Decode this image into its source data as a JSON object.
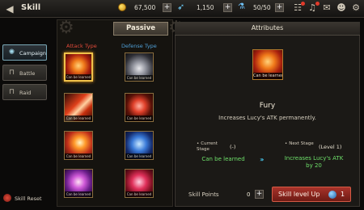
{
  "header": {
    "title": "Skill",
    "gold": "67,500",
    "feathers": "1,150",
    "stamina": "50/50"
  },
  "nav": {
    "items": [
      {
        "label": "Campaign",
        "active": true
      },
      {
        "label": "Battle",
        "active": false
      },
      {
        "label": "Raid",
        "active": false
      }
    ],
    "reset_label": "Skill Reset"
  },
  "skills": {
    "tab_label": "Passive",
    "attack_header": "Attack Type",
    "defense_header": "Defense Type",
    "caption": "Can be learned"
  },
  "attributes": {
    "header": "Attributes",
    "skill_caption": "Can be learned",
    "skill_name": "Fury",
    "description": "Increases Lucy's ATK permanently.",
    "current_stage_label": "Current Stage",
    "current_stage_value": "(-)",
    "current_effect": "Can be learned",
    "next_stage_label": "Next Stage",
    "next_stage_value": "(Level 1)",
    "next_effect_line1": "Increases Lucy's ATK",
    "next_effect_line2": "by 20",
    "skill_points_label": "Skill Points",
    "skill_points_value": "0",
    "level_up_label": "Skill level Up",
    "level_up_cost": "1"
  },
  "colors": {
    "accent_red": "#a8332a",
    "green_text": "#6ee06a",
    "attack_color": "#e04a3a",
    "defense_color": "#4f9fd6"
  }
}
